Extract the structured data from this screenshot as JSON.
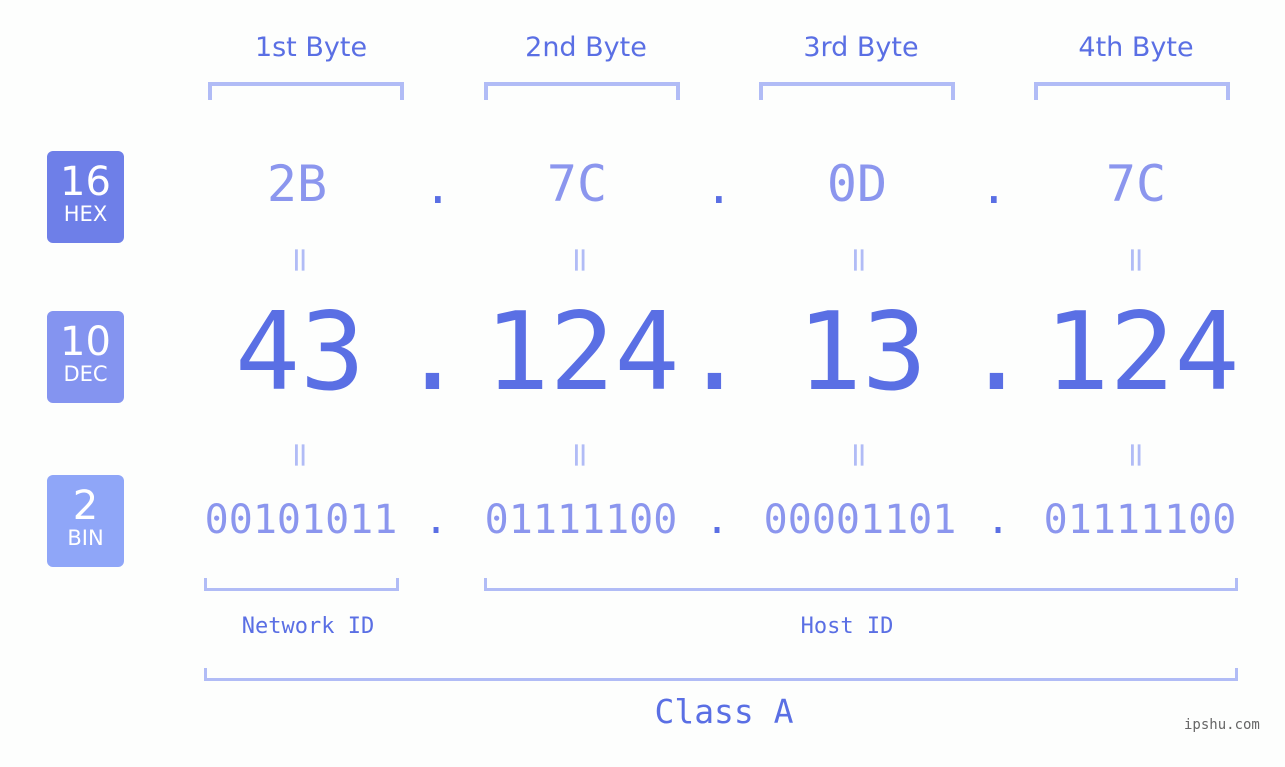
{
  "headers": [
    "1st Byte",
    "2nd Byte",
    "3rd Byte",
    "4th Byte"
  ],
  "badges": {
    "hex": {
      "number": "16",
      "label": "HEX",
      "color": "#6e7fe8"
    },
    "dec": {
      "number": "10",
      "label": "DEC",
      "color": "#8494f0"
    },
    "bin": {
      "number": "2",
      "label": "BIN",
      "color": "#8fa6f8"
    }
  },
  "hex": [
    "2B",
    "7C",
    "0D",
    "7C"
  ],
  "dec": [
    "43",
    "124",
    "13",
    "124"
  ],
  "bin": [
    "00101011",
    "01111100",
    "00001101",
    "01111100"
  ],
  "separator": ".",
  "equals": "=",
  "network_label": "Network ID",
  "host_label": "Host ID",
  "class_label": "Class A",
  "watermark": "ipshu.com"
}
